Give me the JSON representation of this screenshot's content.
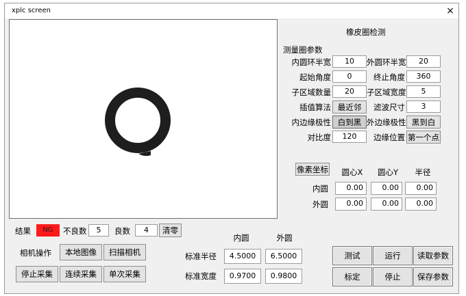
{
  "window": {
    "title": "xplc screen",
    "close_glyph": "×"
  },
  "params": {
    "section_title": "橡皮圈检测",
    "group_title": "测量圈参数",
    "rows": [
      {
        "left_label": "内圆环半宽",
        "left_value": "10",
        "right_label": "外圆环半宽",
        "right_value": "20"
      },
      {
        "left_label": "起始角度",
        "left_value": "0",
        "right_label": "终止角度",
        "right_value": "360"
      },
      {
        "left_label": "子区域数量",
        "left_value": "20",
        "right_label": "子区域宽度",
        "right_value": "5"
      }
    ],
    "interp_label": "插值算法",
    "interp_value": "最近邻",
    "filter_label": "滤波尺寸",
    "filter_value": "3",
    "inner_polarity_label": "内边缘极性",
    "inner_polarity_value": "白到黑",
    "outer_polarity_label": "外边缘极性",
    "outer_polarity_value": "黑到白",
    "contrast_label": "对比度",
    "contrast_value": "120",
    "edge_pos_label": "边缘位置",
    "edge_pos_value": "第一个点"
  },
  "coords": {
    "pixel_button": "像素坐标",
    "col_cx": "圆心X",
    "col_cy": "圆心Y",
    "col_r": "半径",
    "rows": [
      {
        "label": "内圆",
        "cx": "0.00",
        "cy": "0.00",
        "r": "0.00"
      },
      {
        "label": "外圆",
        "cx": "0.00",
        "cy": "0.00",
        "r": "0.00"
      }
    ]
  },
  "result": {
    "label": "结果",
    "status": "NG",
    "status_color": "#ff1a1a",
    "bad_label": "不良数",
    "bad_value": "5",
    "good_label": "良数",
    "good_value": "4",
    "clear_button": "清零"
  },
  "camera": {
    "label": "相机操作",
    "local_image": "本地图像",
    "scan_camera": "扫描相机",
    "stop_capture": "停止采集",
    "continuous_capture": "连续采集",
    "single_capture": "单次采集"
  },
  "standard": {
    "col_inner": "内圆",
    "col_outer": "外圆",
    "radius_label": "标准半径",
    "radius_inner": "4.5000",
    "radius_outer": "6.5000",
    "width_label": "标准宽度",
    "width_inner": "0.9700",
    "width_outer": "0.9800"
  },
  "actions": {
    "test": "测试",
    "run": "运行",
    "read_params": "读取参数",
    "calibrate": "标定",
    "stop": "停止",
    "save_params": "保存参数"
  }
}
